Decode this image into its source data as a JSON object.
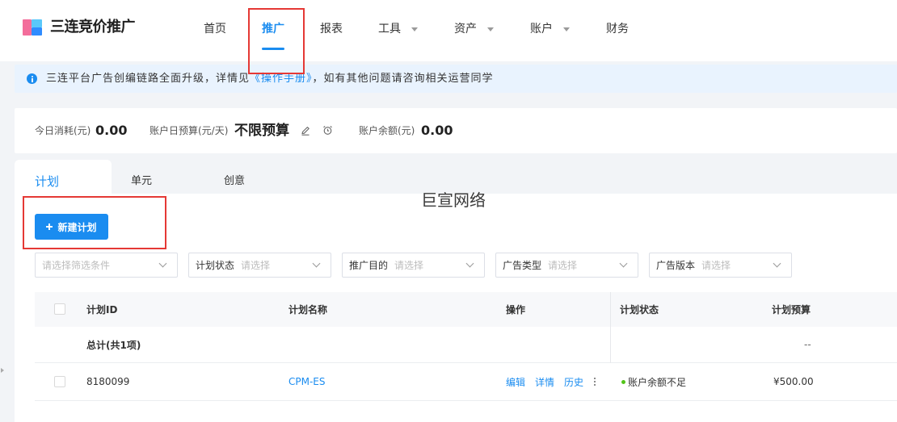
{
  "app": {
    "name": "三连竞价推广",
    "logo_icon": "logo-icon"
  },
  "nav": {
    "items": [
      {
        "label": "首页",
        "active": false,
        "dropdown": false
      },
      {
        "label": "推广",
        "active": true,
        "dropdown": false
      },
      {
        "label": "报表",
        "active": false,
        "dropdown": false
      },
      {
        "label": "工具",
        "active": false,
        "dropdown": true
      },
      {
        "label": "资产",
        "active": false,
        "dropdown": true
      },
      {
        "label": "账户",
        "active": false,
        "dropdown": true
      },
      {
        "label": "财务",
        "active": false,
        "dropdown": false
      }
    ]
  },
  "notice": {
    "icon": "info-icon",
    "text_before": "三连平台广告创编链路全面升级，详情见",
    "link": "《操作手册》",
    "text_after": "，如有其他问题请咨询相关运营同学"
  },
  "stats": {
    "today_spend": {
      "label": "今日消耗(元)",
      "value": "0.00"
    },
    "daily_budget": {
      "label": "账户日预算(元/天)",
      "value": "不限预算",
      "edit_icon": "edit-icon",
      "schedule_icon": "alarm-clock-icon"
    },
    "balance": {
      "label": "账户余额(元)",
      "value": "0.00"
    }
  },
  "tabs": [
    {
      "label": "计划",
      "active": true
    },
    {
      "label": "单元",
      "active": false
    },
    {
      "label": "创意",
      "active": false
    }
  ],
  "watermark": "巨宣网络",
  "toolbar": {
    "new_plan_label": "新建计划",
    "new_plan_icon": "plus-icon"
  },
  "filters": [
    {
      "placeholder": "请选择筛选条件"
    },
    {
      "label": "计划状态",
      "placeholder": "请选择"
    },
    {
      "label": "推广目的",
      "placeholder": "请选择"
    },
    {
      "label": "广告类型",
      "placeholder": "请选择"
    },
    {
      "label": "广告版本",
      "placeholder": "请选择"
    }
  ],
  "table": {
    "columns": [
      "计划ID",
      "计划名称",
      "操作",
      "计划状态",
      "计划预算"
    ],
    "summary": {
      "label": "总计(共1项)",
      "budget": "--"
    },
    "rows": [
      {
        "id": "8180099",
        "name": "CPM-ES",
        "actions": [
          "编辑",
          "详情",
          "历史"
        ],
        "more_icon": "more-vertical-icon",
        "status": "账户余额不足",
        "status_color": "#52c41a",
        "budget": "¥500.00"
      }
    ]
  },
  "colors": {
    "accent": "#1a8cf0",
    "annotation": "#e53935",
    "status_ok": "#52c41a"
  }
}
